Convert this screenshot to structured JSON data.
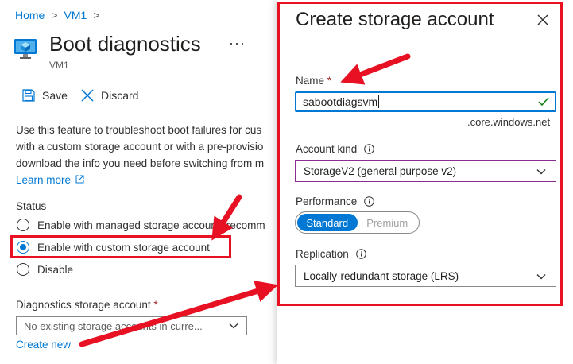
{
  "breadcrumb": {
    "home": "Home",
    "vm": "VM1",
    "sep": ">"
  },
  "page": {
    "title": "Boot diagnostics",
    "subtitle": "VM1",
    "more": "···"
  },
  "toolbar": {
    "save_label": "Save",
    "discard_label": "Discard"
  },
  "description": {
    "line1": "Use this feature to troubleshoot boot failures for cus",
    "line2": "with a custom storage account or with a pre-provisio",
    "line3": "download the info you need before switching from m",
    "learn_more": "Learn more"
  },
  "status": {
    "label": "Status",
    "options": [
      {
        "label": "Enable with managed storage account (recomm",
        "checked": false
      },
      {
        "label": "Enable with custom storage account",
        "checked": true
      },
      {
        "label": "Disable",
        "checked": false
      }
    ]
  },
  "diagnostics": {
    "label": "Diagnostics storage account",
    "required": "*",
    "placeholder": "No existing storage accounts in curre...",
    "create_new": "Create new"
  },
  "panel": {
    "title": "Create storage account",
    "name": {
      "label": "Name",
      "required": "*",
      "value": "sabootdiagsvm",
      "suffix": ".core.windows.net"
    },
    "account_kind": {
      "label": "Account kind",
      "value": "StorageV2 (general purpose v2)"
    },
    "performance": {
      "label": "Performance",
      "options": [
        "Standard",
        "Premium"
      ],
      "selected": "Standard"
    },
    "replication": {
      "label": "Replication",
      "value": "Locally-redundant storage (LRS)"
    }
  },
  "colors": {
    "accent": "#0078d4",
    "annotation": "#e81123",
    "required": "#a4262c",
    "valid": "#107c10"
  }
}
